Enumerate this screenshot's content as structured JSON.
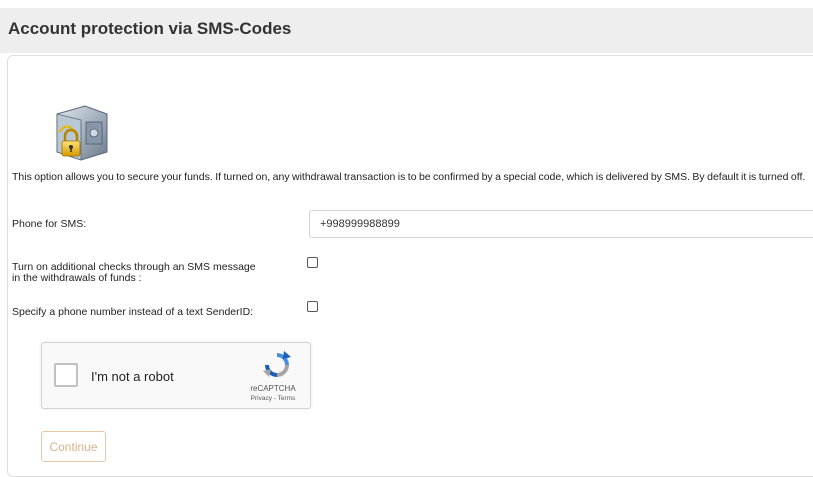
{
  "header": {
    "title": "Account protection via SMS-Codes"
  },
  "icon": {
    "name": "safe-lock-icon"
  },
  "description": "This option allows you to secure your funds. If turned on, any withdrawal transaction is to be confirmed by a special code, which is delivered by SMS. By default it is turned off.",
  "form": {
    "phone_label": "Phone for SMS:",
    "phone_value": "+998999988899",
    "withdrawal_checks_label": "Turn on additional checks through an SMS message in the withdrawals of funds :",
    "sender_id_label": "Specify a phone number instead of a text SenderID:"
  },
  "captcha": {
    "label": "I'm not a robot",
    "brand": "reCAPTCHA",
    "links": "Privacy - Terms"
  },
  "buttons": {
    "continue": "Continue"
  },
  "colors": {
    "accent": "#e7c7a8",
    "header_bg": "#eeeeee"
  }
}
